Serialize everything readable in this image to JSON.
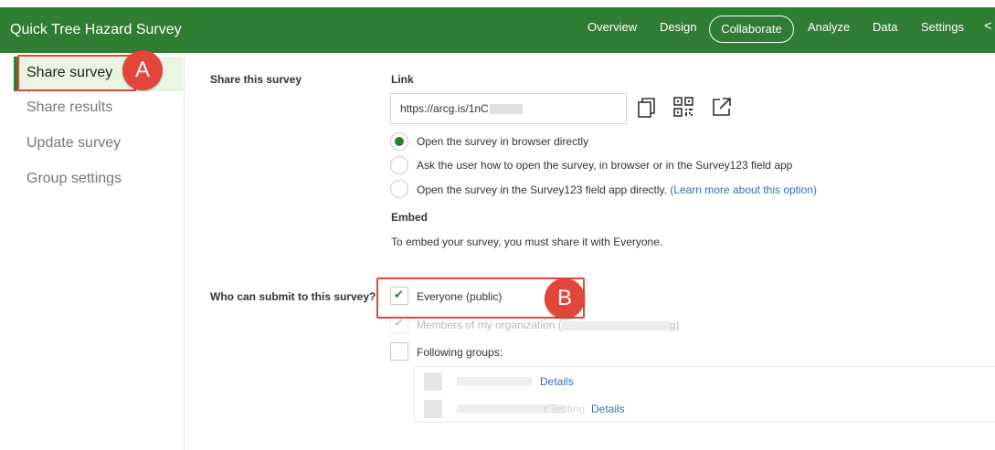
{
  "header": {
    "app_title": "Quick Tree Hazard Survey",
    "nav": {
      "overview": "Overview",
      "design": "Design",
      "collaborate": "Collaborate",
      "analyze": "Analyze",
      "data": "Data",
      "settings": "Settings",
      "more": "<"
    }
  },
  "sidebar": {
    "items": [
      {
        "label": "Share survey",
        "active": true
      },
      {
        "label": "Share results"
      },
      {
        "label": "Update survey"
      },
      {
        "label": "Group settings"
      }
    ]
  },
  "annotations": {
    "a": "A",
    "b": "B"
  },
  "share": {
    "section_label": "Share this survey",
    "link_heading": "Link",
    "link_value": "https://arcg.is/1nC",
    "icons": [
      "copy-icon",
      "qr-code-icon",
      "open-external-icon"
    ],
    "options": [
      {
        "label": "Open the survey in browser directly",
        "checked": true
      },
      {
        "label": "Ask the user how to open the survey, in browser or in the Survey123 field app",
        "checked": false
      },
      {
        "label": "Open the survey in the Survey123 field app directly.",
        "link": "(Learn more about this option)",
        "checked": false
      }
    ],
    "embed_heading": "Embed",
    "embed_text": "To embed your survey, you must share it with Everyone."
  },
  "submit": {
    "section_label": "Who can submit to this survey?",
    "everyone_label": "Everyone (public)",
    "members_label": "Members of my organization (",
    "members_suffix": "g)",
    "following_groups_label": "Following groups:",
    "groups": [
      {
        "details_label": "Details"
      },
      {
        "name_fragment": "r Testing",
        "details_label": "Details"
      }
    ]
  },
  "colors": {
    "brand_green": "#2f7d32",
    "annotation_red": "#e2453a",
    "link_blue": "#2f72b8"
  }
}
